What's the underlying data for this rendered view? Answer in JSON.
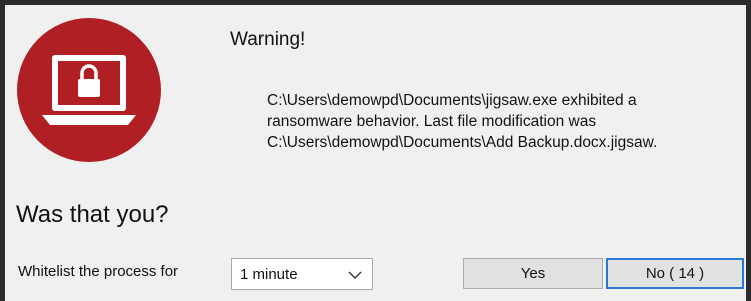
{
  "dialog": {
    "title": "Warning!",
    "message_lines": [
      "C:\\Users\\demowpd\\Documents\\jigsaw.exe exhibited a",
      "ransomware  behavior. Last file modification was",
      "C:\\Users\\demowpd\\Documents\\Add Backup.docx.jigsaw."
    ],
    "question": "Was that you?",
    "whitelist_label": "Whitelist the process for",
    "whitelist_duration": "1 minute",
    "yes_label": "Yes",
    "no_label": "No ( 14 )"
  },
  "icons": {
    "alert": "laptop-lock-icon",
    "dropdown": "chevron-down-icon"
  },
  "colors": {
    "icon_red": "#b01f24",
    "default_button_border": "#2a78d6"
  }
}
